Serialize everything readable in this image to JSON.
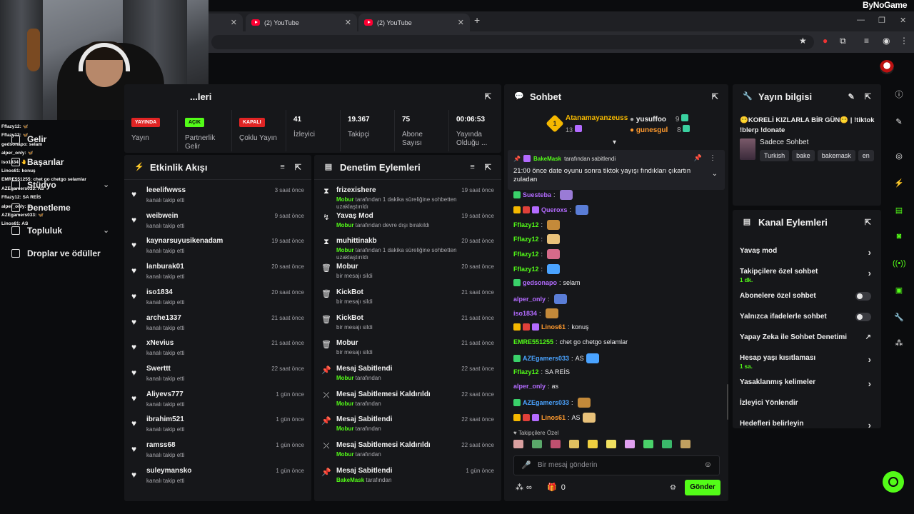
{
  "browser": {
    "tabs": [
      {
        "label": ""
      },
      {
        "label": "(2) YouTube"
      },
      {
        "label": "(2) YouTube"
      }
    ],
    "new_tab": "+",
    "brand": "ByNoGame"
  },
  "overlay_chat": [
    "Fflazy12: 🦋",
    "Fflazy12: 🦋",
    "gedsonapo: selam",
    "alper_only: 🦋",
    "iso1834: 🤚",
    "Linos61: konuş",
    "EMRE551255: chet go chetgo selamlar",
    "AZEgamers033: AS",
    "Fflazy12: SA REİS",
    "alper_only: as",
    "AZEgamers033: 🦋",
    "Linos61: AS"
  ],
  "sidebar": {
    "items": [
      {
        "label": "Gelir"
      },
      {
        "label": "Başarılar"
      },
      {
        "label": "Stüdyo"
      },
      {
        "label": "Denetleme"
      },
      {
        "label": "Topluluk"
      },
      {
        "label": "Droplar ve ödüller"
      }
    ]
  },
  "stats": {
    "title": "...leri",
    "items": [
      {
        "badge": "YAYINDA",
        "label": "Yayın"
      },
      {
        "badge": "AÇIK",
        "label": "Partnerlik Gelir"
      },
      {
        "badge": "KAPALI",
        "label": "Çoklu Yayın"
      },
      {
        "value": "41",
        "label": "İzleyici"
      },
      {
        "value": "19.367",
        "label": "Takipçi"
      },
      {
        "value": "75",
        "label": "Abone Sayısı"
      },
      {
        "value": "00:06:53",
        "label": "Yayında Olduğu ..."
      }
    ]
  },
  "activity": {
    "title": "Etkinlik Akışı",
    "sub": "kanalı takip etti",
    "rows": [
      {
        "name": "leeelifwwss",
        "time": "3 saat önce"
      },
      {
        "name": "weibwein",
        "time": "9 saat önce"
      },
      {
        "name": "kaynarsuyusikenadam",
        "time": "19 saat önce"
      },
      {
        "name": "lanburak01",
        "time": "20 saat önce"
      },
      {
        "name": "iso1834",
        "time": "20 saat önce"
      },
      {
        "name": "arche1337",
        "time": "21 saat önce"
      },
      {
        "name": "xNevius",
        "time": "21 saat önce"
      },
      {
        "name": "Swerttt",
        "time": "22 saat önce"
      },
      {
        "name": "Aliyevs777",
        "time": "1 gün önce"
      },
      {
        "name": "ibrahim521",
        "time": "1 gün önce"
      },
      {
        "name": "ramss68",
        "time": "1 gün önce"
      },
      {
        "name": "suleymansko",
        "time": "1 gün önce"
      }
    ]
  },
  "moderation": {
    "title": "Denetim Eylemleri",
    "rows": [
      {
        "icon": "⧗",
        "name": "frizexishere",
        "by": "Mobur",
        "text": " tarafından 1 dakika süreliğine sohbetten uzaklaştırıldı",
        "time": "19 saat önce"
      },
      {
        "icon": "↯",
        "name": "Yavaş Mod",
        "by": "Mobur",
        "text": " tarafından devre dışı bırakıldı",
        "time": "19 saat önce"
      },
      {
        "icon": "⧗",
        "name": "muhittinakb",
        "by": "Mobur",
        "text": " tarafından 1 dakika süreliğine sohbetten uzaklaştırıldı",
        "time": "20 saat önce"
      },
      {
        "icon": "🗑",
        "name": "Mobur",
        "by": "",
        "text": "bir mesajı sildi",
        "time": "20 saat önce"
      },
      {
        "icon": "🗑",
        "name": "KickBot",
        "by": "",
        "text": "bir mesajı sildi",
        "time": "21 saat önce"
      },
      {
        "icon": "🗑",
        "name": "KickBot",
        "by": "",
        "text": "bir mesajı sildi",
        "time": "21 saat önce"
      },
      {
        "icon": "🗑",
        "name": "Mobur",
        "by": "",
        "text": "bir mesajı sildi",
        "time": "21 saat önce"
      },
      {
        "icon": "📌",
        "name": "Mesaj Sabitlendi",
        "by": "Mobur",
        "text": " tarafından",
        "time": "22 saat önce"
      },
      {
        "icon": "⤫",
        "name": "Mesaj Sabitlemesi Kaldırıldı",
        "by": "Mobur",
        "text": " tarafından",
        "time": "22 saat önce"
      },
      {
        "icon": "📌",
        "name": "Mesaj Sabitlendi",
        "by": "Mobur",
        "text": " tarafından",
        "time": "22 saat önce"
      },
      {
        "icon": "⤫",
        "name": "Mesaj Sabitlemesi Kaldırıldı",
        "by": "Mobur",
        "text": " tarafından",
        "time": "22 saat önce"
      },
      {
        "icon": "📌",
        "name": "Mesaj Sabitlendi",
        "by": "BakeMask",
        "text": " tarafından",
        "time": "1 gün önce"
      }
    ]
  },
  "chat": {
    "title": "Sohbet",
    "top": {
      "rank": "1",
      "leader": "Atanamayanzeuss",
      "leader_count": "13",
      "second": "yusuffoo",
      "second_count": "9",
      "third": "gunesgul",
      "third_count": "8"
    },
    "pinned": {
      "user": "BakeMask",
      "suffix": " tarafından sabitlendi",
      "text": "21:00 önce date oyunu sonra tiktok yayışı fındıkları çıkartın zuladan"
    },
    "messages": [
      {
        "user": "Suesteba",
        "color": "#b36bff",
        "text": ""
      },
      {
        "user": "Queroxs",
        "color": "#b36bff",
        "text": ""
      },
      {
        "user": "Fflazy12",
        "color": "#53fc18",
        "text": ""
      },
      {
        "user": "Fflazy12",
        "color": "#53fc18",
        "text": ""
      },
      {
        "user": "Fflazy12",
        "color": "#53fc18",
        "text": ""
      },
      {
        "user": "Fflazy12",
        "color": "#53fc18",
        "text": ""
      },
      {
        "user": "gedsonapo",
        "color": "#b36bff",
        "text": " selam"
      },
      {
        "user": "alper_only",
        "color": "#b36bff",
        "text": ""
      },
      {
        "user": "iso1834",
        "color": "#b36bff",
        "text": ""
      },
      {
        "user": "Linos61",
        "color": "#ff9a2e",
        "text": " konuş"
      },
      {
        "user": "EMRE551255",
        "color": "#53fc18",
        "text": " chet go chetgo selamlar"
      },
      {
        "user": "AZEgamers033",
        "color": "#4aa3ff",
        "text": " AS"
      },
      {
        "user": "Fflazy12",
        "color": "#53fc18",
        "text": " SA REİS"
      },
      {
        "user": "alper_only",
        "color": "#b36bff",
        "text": " as"
      },
      {
        "user": "AZEgamers033",
        "color": "#4aa3ff",
        "text": ""
      },
      {
        "user": "Linos61",
        "color": "#ff9a2e",
        "text": " AS"
      }
    ],
    "followers_only": "Takipçilere Özel",
    "placeholder": "Bir mesaj gönderin",
    "infinity": "∞",
    "gift_count": "0",
    "send": "Gönder"
  },
  "stream_info": {
    "title": "Yayın bilgisi",
    "stream_title": "😶KORELİ KIZLARLA BİR GÜN😶 | !tiktok !blerp !donate",
    "category": "Sadece Sohbet",
    "tags": [
      "Turkish",
      "bake",
      "bakemask",
      "en"
    ]
  },
  "channel_actions": {
    "title": "Kanal Eylemleri",
    "rows": [
      {
        "label": "Yavaş mod",
        "sub": "",
        "control": "chevron"
      },
      {
        "label": "Takipçilere özel sohbet",
        "sub": "1 dk.",
        "control": "chevron"
      },
      {
        "label": "Abonelere özel sohbet",
        "sub": "",
        "control": "toggle"
      },
      {
        "label": "Yalnızca ifadelerle sohbet",
        "sub": "",
        "control": "toggle"
      },
      {
        "label": "Yapay Zeka ile Sohbet Denetimi",
        "sub": "",
        "control": "external"
      },
      {
        "label": "Hesap yaşı kısıtlaması",
        "sub": "1 sa.",
        "control": "chevron"
      },
      {
        "label": "Yasaklanmış kelimeler",
        "sub": "",
        "control": "chevron"
      },
      {
        "label": "İzleyici Yönlendir",
        "sub": "",
        "control": "none"
      },
      {
        "label": "Hedefleri belirleyin",
        "sub": "",
        "control": "chevron"
      }
    ]
  },
  "colors": {
    "accent": "#53fc18",
    "live": "#e02424",
    "panel": "#16171a"
  }
}
